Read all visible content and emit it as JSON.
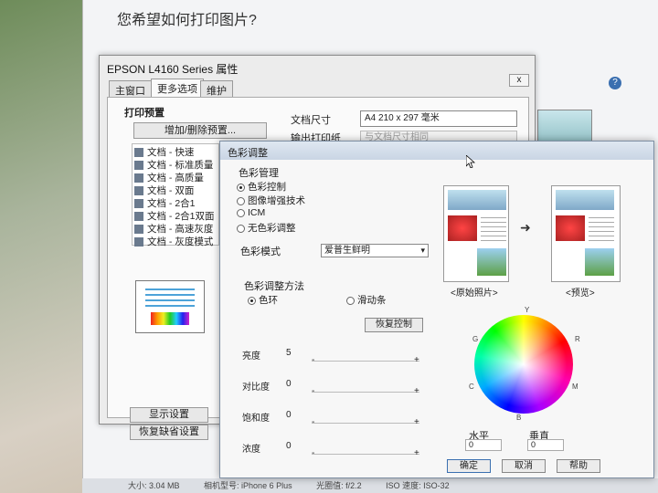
{
  "background_window": {
    "title": "您希望如何打印图片?",
    "help_label": "?",
    "status": {
      "size": "大小: 3.04 MB",
      "camera": "相机型号: iPhone 6 Plus",
      "aperture": "光圈值: f/2.2",
      "iso": "ISO 速度: ISO-32"
    }
  },
  "printer_props": {
    "title": "EPSON L4160 Series 属性",
    "close_label": "x",
    "tabs": [
      "主窗口",
      "更多选项",
      "维护"
    ],
    "active_tab": 1,
    "preset_title": "打印预置",
    "preset_button": "增加/删除预置...",
    "presets": [
      "文档 - 快速",
      "文档 - 标准质量",
      "文档 - 高质量",
      "文档 - 双面",
      "文档 - 2合1",
      "文档 - 2合1双面",
      "文档 - 高速灰度",
      "文档 - 灰度模式"
    ],
    "paper_size_label": "文档尺寸",
    "paper_size_value": "A4 210 x 297 毫米",
    "output_label": "输出打印纸",
    "output_value": "与文档尺寸相同",
    "show_settings": "显示设置",
    "restore_defaults": "恢复缺省设置"
  },
  "color_dialog": {
    "title": "色彩调整",
    "color_mgmt_title": "色彩管理",
    "color_mgmt_options": [
      {
        "label": "色彩控制",
        "selected": true
      },
      {
        "label": "图像增强技术",
        "selected": false
      },
      {
        "label": "ICM",
        "selected": false
      },
      {
        "label": "无色彩调整",
        "selected": false
      }
    ],
    "color_mode_label": "色彩模式",
    "color_mode_value": "爱普生鲜明",
    "method_title": "色彩调整方法",
    "method_options": [
      {
        "label": "色环",
        "selected": true
      },
      {
        "label": "滑动条",
        "selected": false
      }
    ],
    "restore_control": "恢复控制",
    "sliders": [
      {
        "label": "亮度",
        "value": "5"
      },
      {
        "label": "对比度",
        "value": "0"
      },
      {
        "label": "饱和度",
        "value": "0"
      },
      {
        "label": "浓度",
        "value": "0"
      }
    ],
    "original_label": "<原始照片>",
    "preview_label": "<预览>",
    "wheel_labels": {
      "top": "Y",
      "right": "R",
      "bottom": "B",
      "left": "G",
      "upper_left": "G",
      "lower_left": "C",
      "lower_right": "M"
    },
    "horizontal_label": "水平",
    "vertical_label": "垂直",
    "horizontal_value": "0",
    "vertical_value": "0",
    "ok": "确定",
    "cancel": "取消",
    "help": "帮助"
  }
}
